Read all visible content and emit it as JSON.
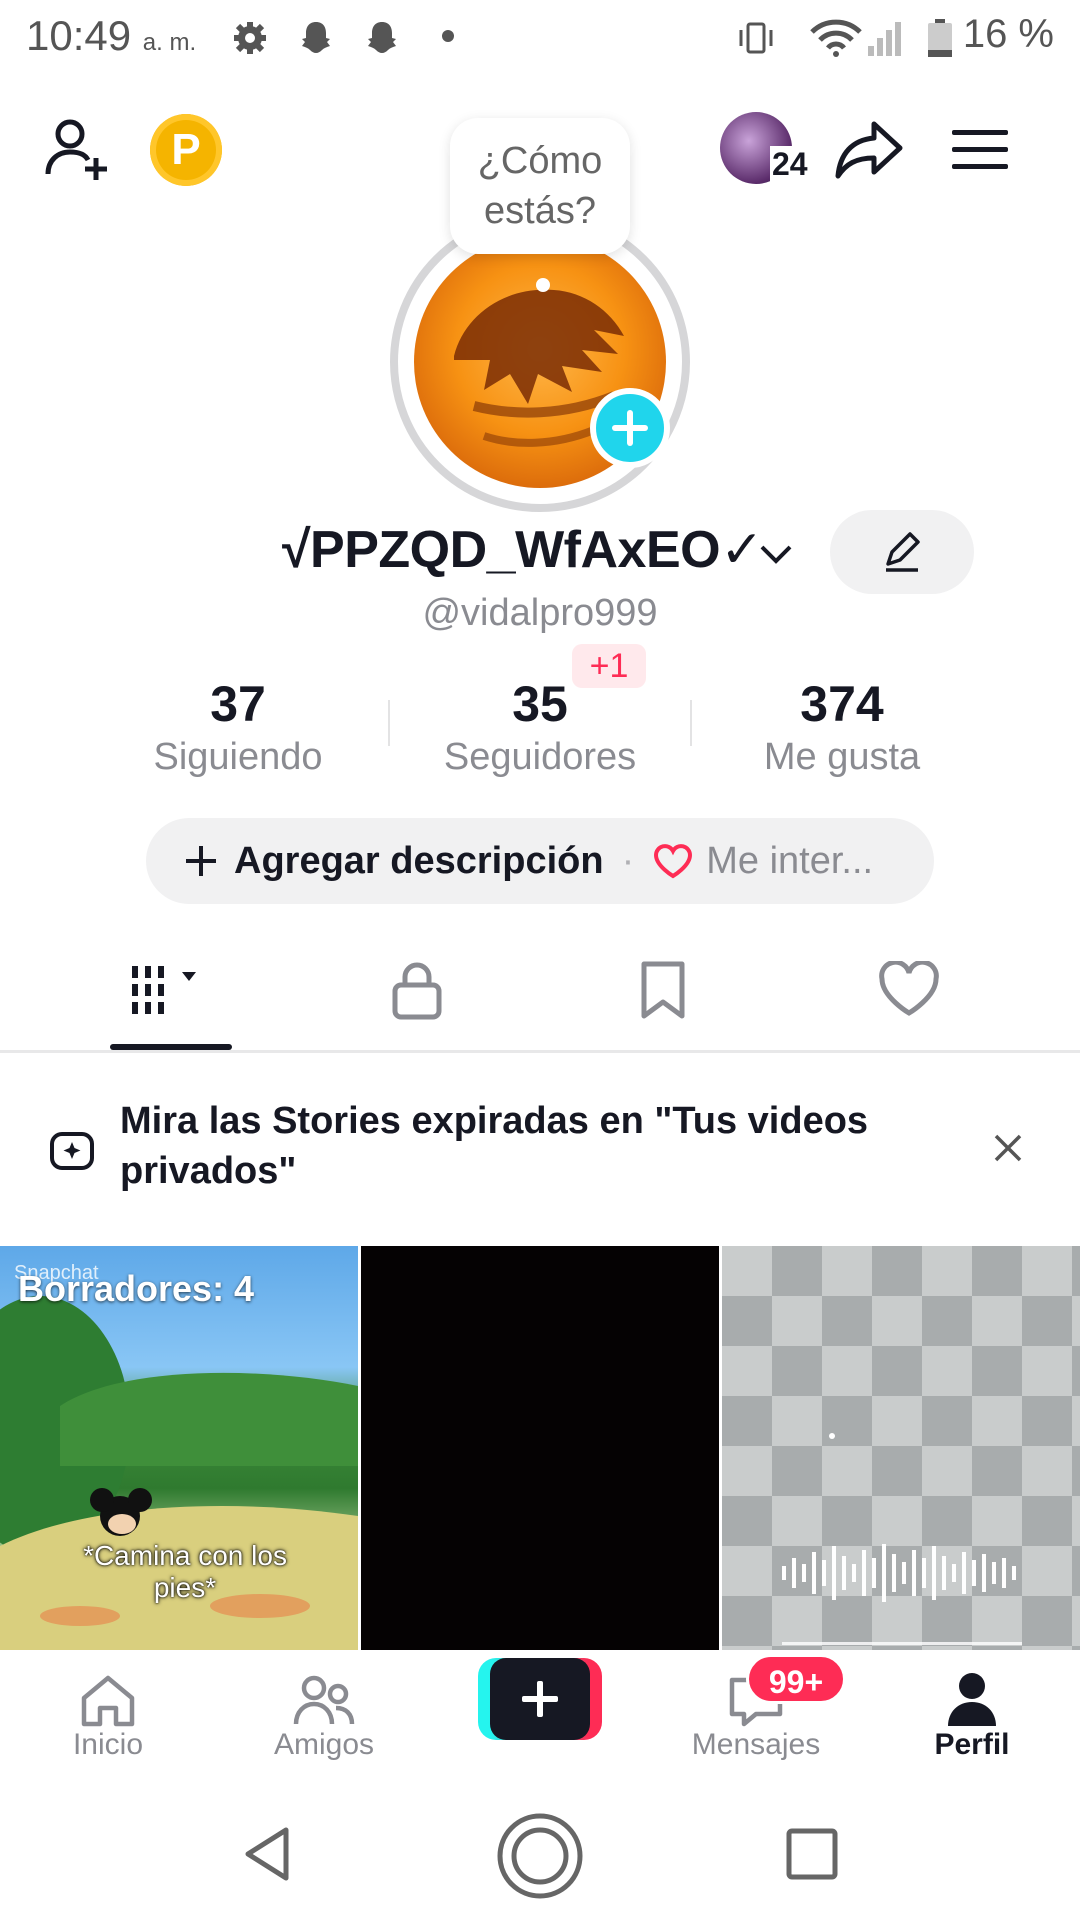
{
  "status_bar": {
    "time": "10:49",
    "ampm": "a. m.",
    "battery": "16 %"
  },
  "header": {
    "notification_count": "24",
    "coin_letter": "P"
  },
  "profile": {
    "bubble_text_1": "¿Cómo",
    "bubble_text_2": "estás?",
    "display_name": "√PPZQD_WfAxEO✓",
    "username": "@vidalpro999",
    "stats": [
      {
        "value": "37",
        "label": "Siguiendo"
      },
      {
        "value": "35",
        "label": "Seguidores",
        "delta": "+1"
      },
      {
        "value": "374",
        "label": "Me gusta"
      }
    ],
    "add_description": "Agregar descripción",
    "interests": "Me inter..."
  },
  "banner": {
    "text": "Mira las Stories expiradas en \"Tus videos privados\""
  },
  "grid": {
    "drafts_label": "Borradores: 4",
    "watermark": "Snapchat",
    "caption": "*Camina con los pies*"
  },
  "bottom_nav": {
    "items": [
      "Inicio",
      "Amigos",
      "Mensajes",
      "Perfil"
    ],
    "messages_badge": "99+",
    "active": "Perfil"
  },
  "colors": {
    "accent_pink": "#fe2c55",
    "accent_cyan": "#20d5ec",
    "text_dark": "#161823",
    "text_gray": "#8a8b91"
  }
}
